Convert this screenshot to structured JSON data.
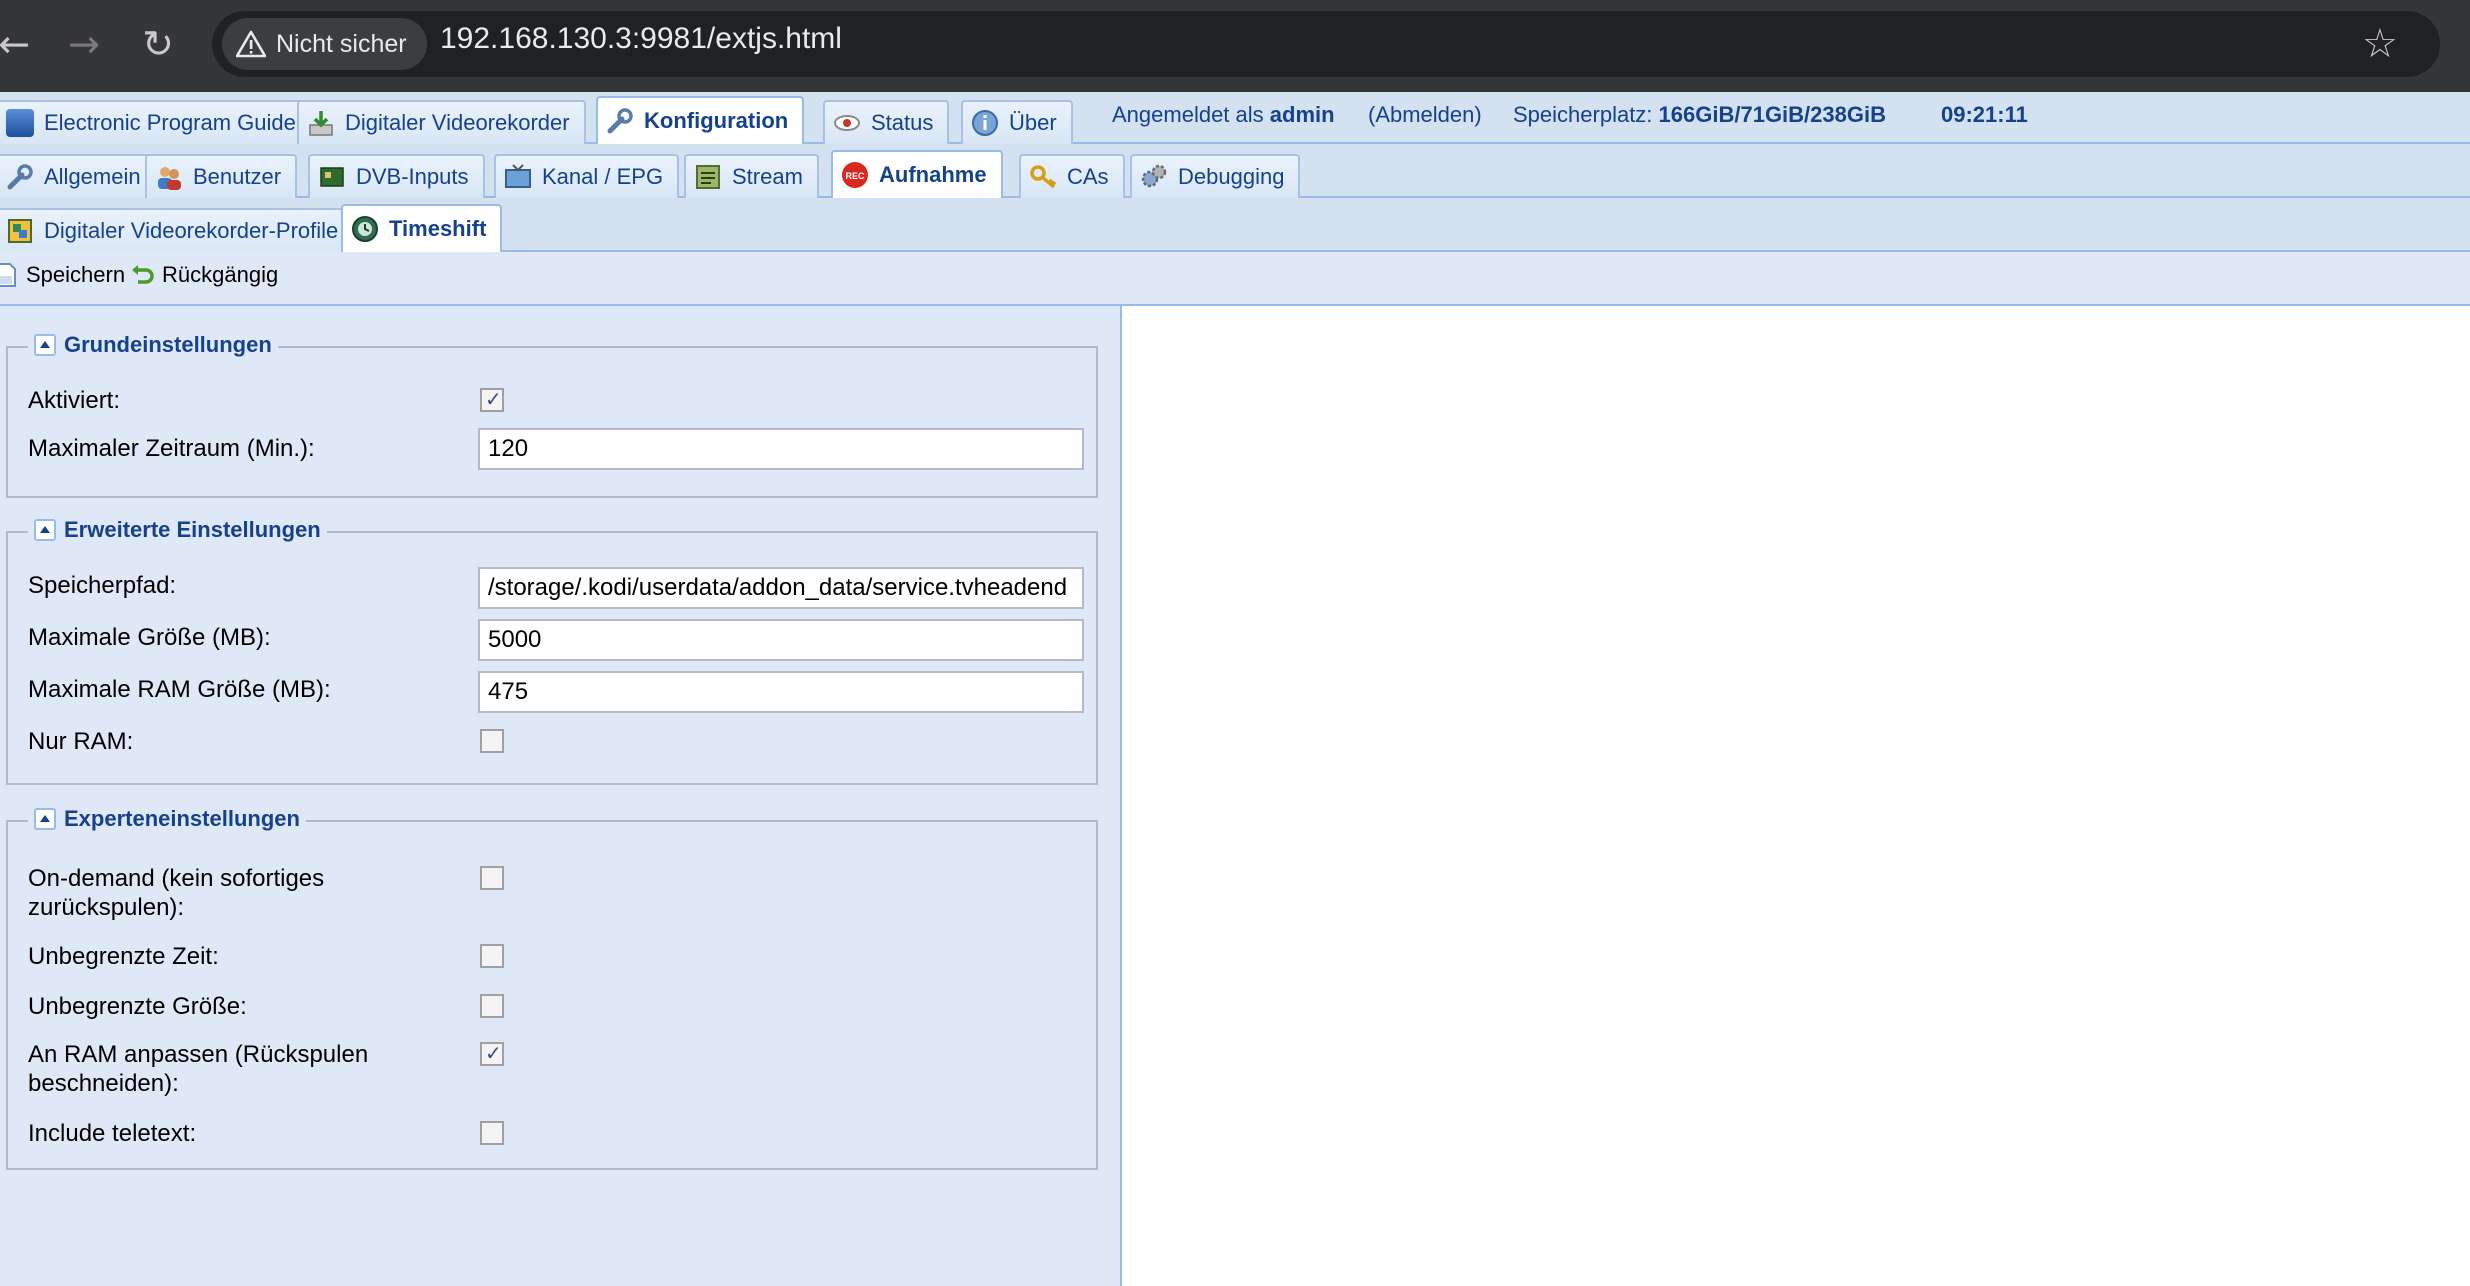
{
  "browser": {
    "security_label": "Nicht sicher",
    "url": "192.168.130.3:9981/extjs.html"
  },
  "main_tabs": [
    {
      "label": "Electronic Program Guide",
      "icon": "epg-icon"
    },
    {
      "label": "Digitaler Videorekorder",
      "icon": "download-icon"
    },
    {
      "label": "Konfiguration",
      "icon": "wrench-icon",
      "active": true
    },
    {
      "label": "Status",
      "icon": "eye-icon"
    },
    {
      "label": "Über",
      "icon": "info-icon"
    }
  ],
  "session": {
    "logged_in_prefix": "Angemeldet als",
    "username": "admin",
    "logout": "(Abmelden)",
    "storage_prefix": "Speicherplatz:",
    "storage_value": "166GiB/71GiB/238GiB",
    "time": "09:21:11"
  },
  "config_tabs": [
    {
      "label": "Allgemein",
      "icon": "wrench-icon"
    },
    {
      "label": "Benutzer",
      "icon": "users-icon"
    },
    {
      "label": "DVB-Inputs",
      "icon": "card-icon"
    },
    {
      "label": "Kanal / EPG",
      "icon": "tv-icon"
    },
    {
      "label": "Stream",
      "icon": "stream-icon"
    },
    {
      "label": "Aufnahme",
      "icon": "rec-icon",
      "active": true
    },
    {
      "label": "CAs",
      "icon": "key-icon"
    },
    {
      "label": "Debugging",
      "icon": "gears-icon"
    }
  ],
  "sub_tabs": [
    {
      "label": "Digitaler Videorekorder-Profile",
      "icon": "profile-icon"
    },
    {
      "label": "Timeshift",
      "icon": "timeshift-icon",
      "active": true
    }
  ],
  "toolbar": {
    "save": "Speichern",
    "undo": "Rückgängig"
  },
  "sections": {
    "basic": {
      "title": "Grundeinstellungen",
      "enabled_label": "Aktiviert:",
      "enabled": true,
      "max_period_label": "Maximaler Zeitraum (Min.):",
      "max_period": "120"
    },
    "advanced": {
      "title": "Erweiterte Einstellungen",
      "path_label": "Speicherpfad:",
      "path": "/storage/.kodi/userdata/addon_data/service.tvheadend",
      "max_size_label": "Maximale Größe (MB):",
      "max_size": "5000",
      "max_ram_label": "Maximale RAM Größe (MB):",
      "max_ram": "475",
      "ram_only_label": "Nur RAM:",
      "ram_only": false
    },
    "expert": {
      "title": "Experteneinstellungen",
      "on_demand_label": "On-demand (kein sofortiges zurückspulen):",
      "on_demand": false,
      "unlimited_time_label": "Unbegrenzte Zeit:",
      "unlimited_time": false,
      "unlimited_size_label": "Unbegrenzte Größe:",
      "unlimited_size": false,
      "fit_ram_label": "An RAM anpassen (Rückspulen beschneiden):",
      "fit_ram": true,
      "teletext_label": "Include teletext:",
      "teletext": false
    }
  },
  "colors": {
    "tab_text": "#15428b",
    "panel_bg": "#dfe8f6",
    "chrome_bg": "#35363a"
  }
}
